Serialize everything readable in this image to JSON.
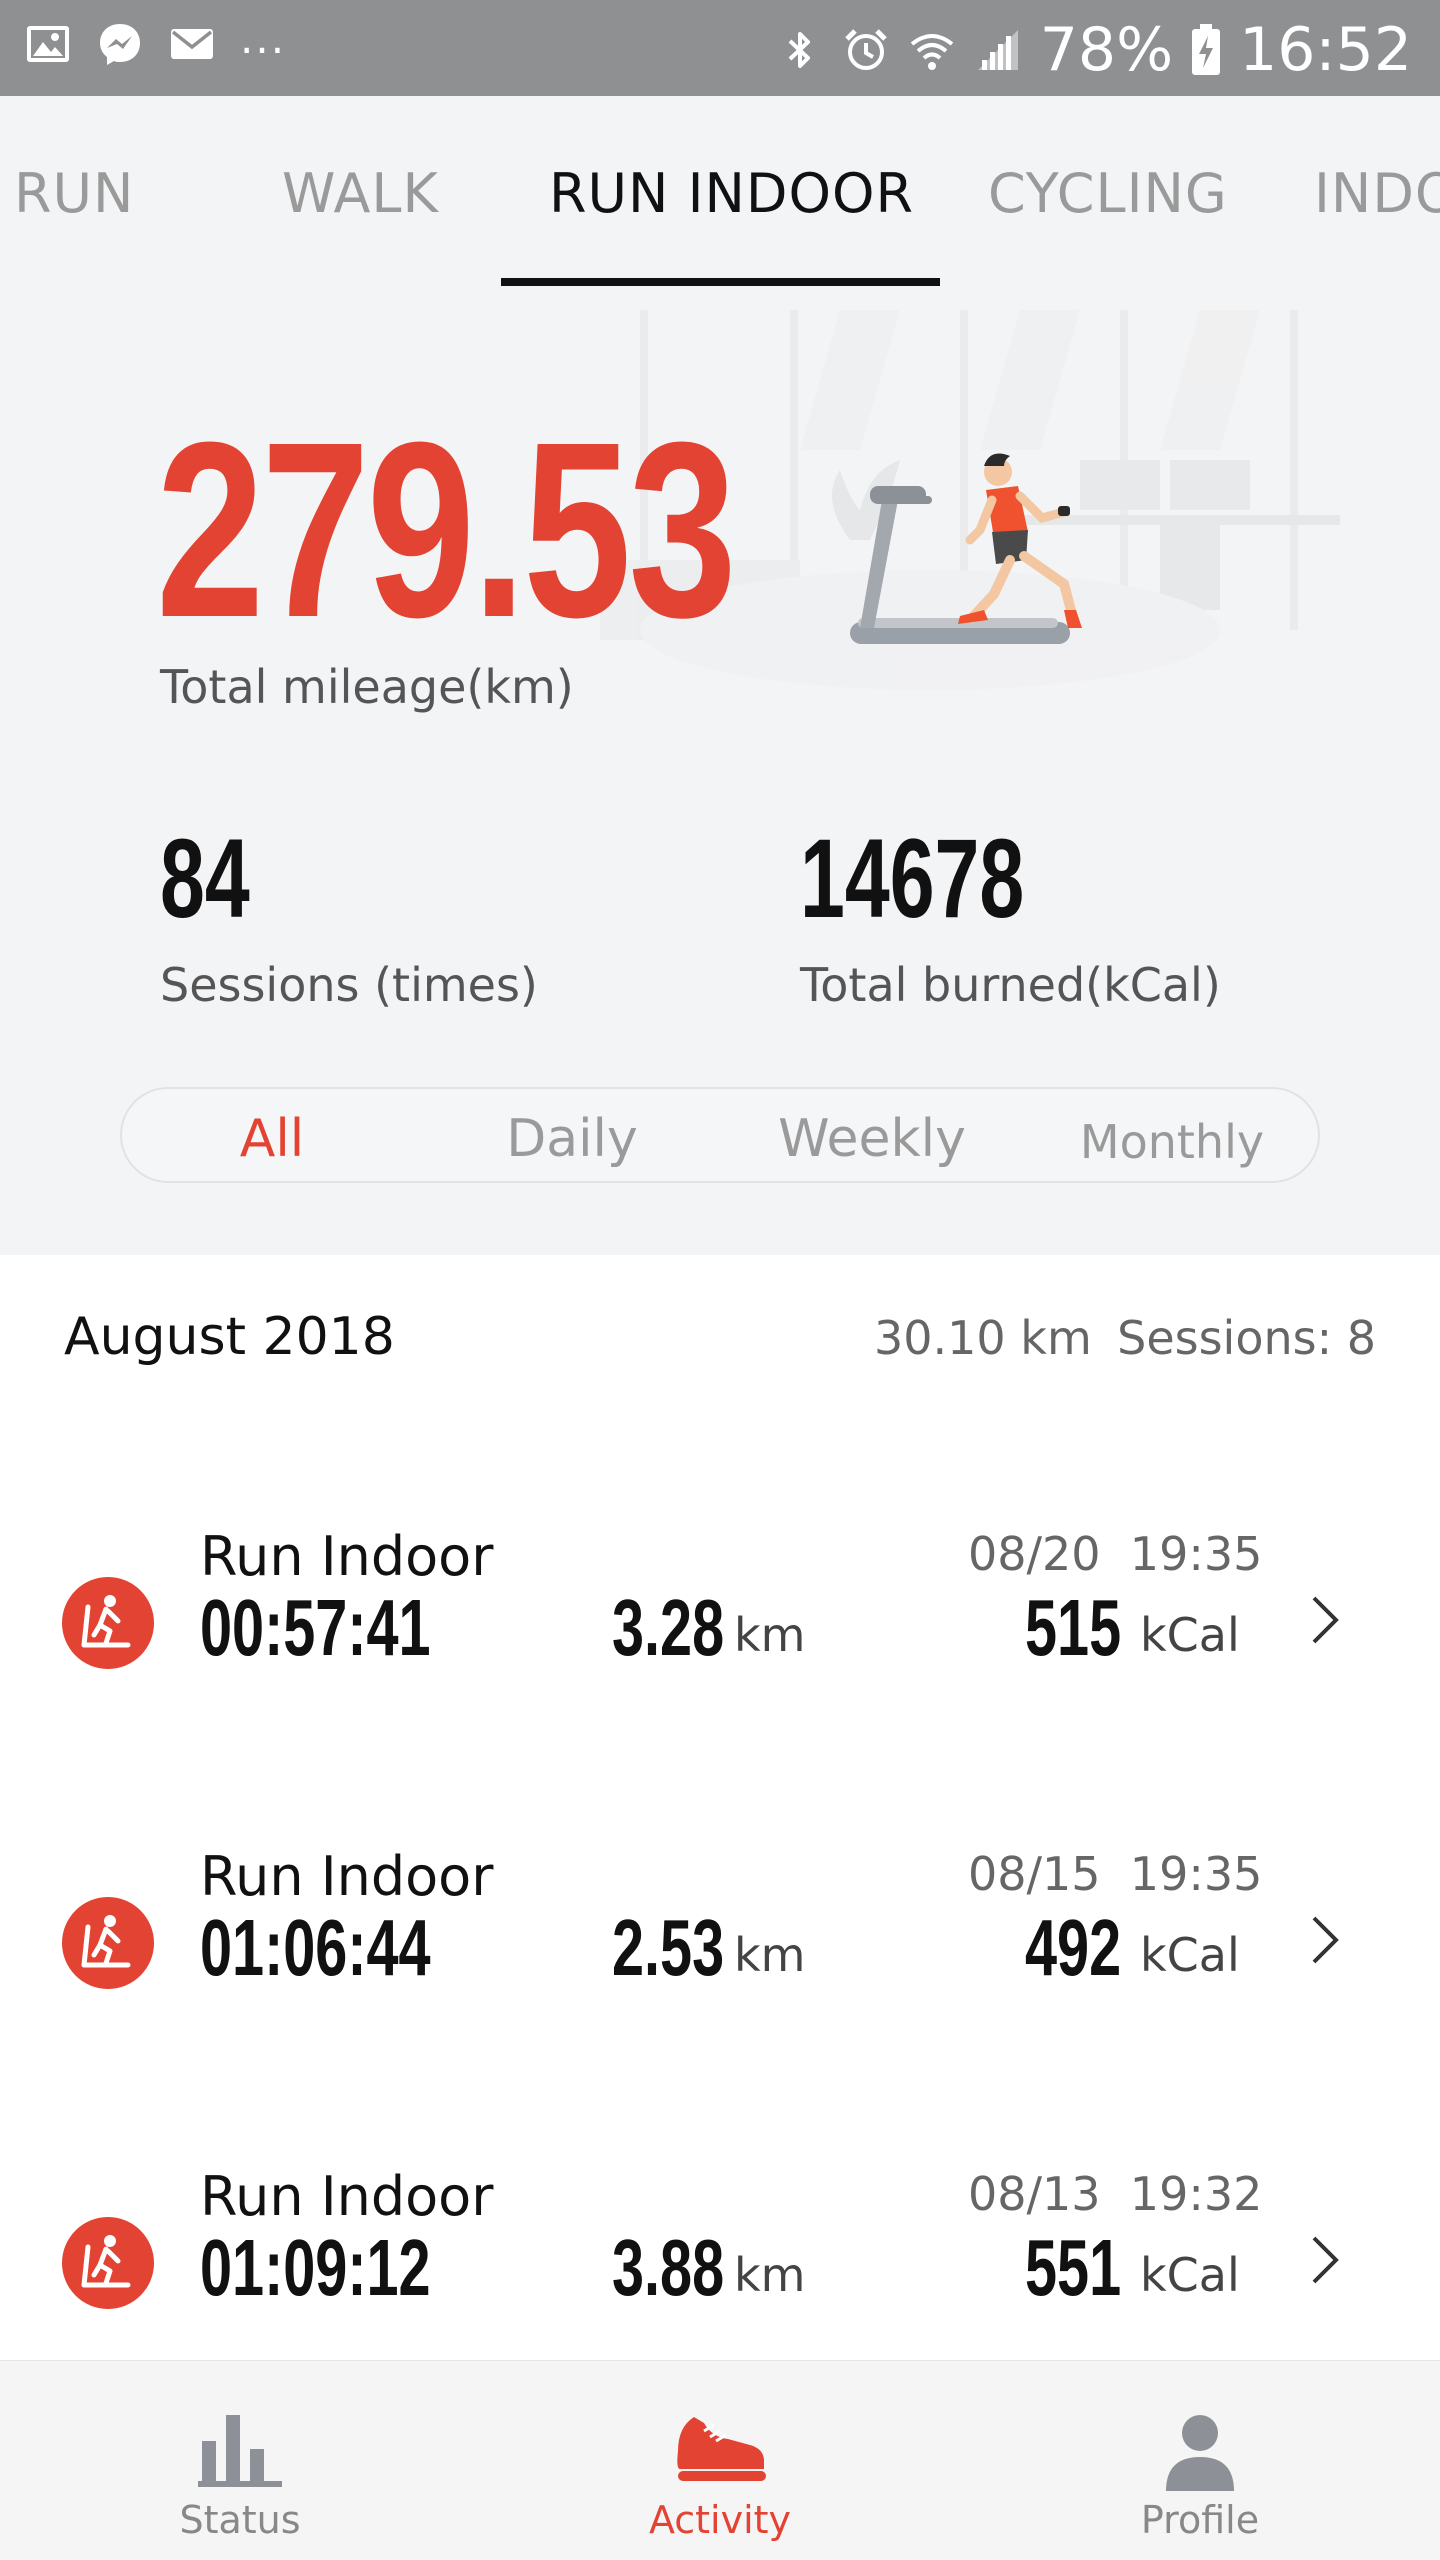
{
  "status_bar": {
    "left_icons": [
      "gallery-icon",
      "messenger-icon",
      "mail-icon"
    ],
    "more": "...",
    "right_icons": [
      "bluetooth-icon",
      "alarm-icon",
      "wifi-icon",
      "signal-icon"
    ],
    "battery_percent": "78%",
    "time": "16:52"
  },
  "tabs": [
    {
      "label": "RUN",
      "active": false
    },
    {
      "label": "WALK",
      "active": false
    },
    {
      "label": "RUN INDOOR",
      "active": true
    },
    {
      "label": "CYCLING",
      "active": false
    },
    {
      "label": "INDO",
      "active": false
    }
  ],
  "summary": {
    "total_mileage": "279.53",
    "total_mileage_label": "Total mileage(km)",
    "sessions": "84",
    "sessions_label": "Sessions (times)",
    "calories": "14678",
    "calories_label": "Total burned(kCal)"
  },
  "filter": {
    "options": [
      "All",
      "Daily",
      "Weekly",
      "Monthly"
    ],
    "selected": "All"
  },
  "month_group": {
    "title": "August 2018",
    "distance": "30.10 km",
    "sessions": "Sessions: 8"
  },
  "activities": [
    {
      "title": "Run Indoor",
      "date": "08/20  19:35",
      "duration": "00:57:41",
      "distance": "3.28",
      "distance_unit": "km",
      "calories": "515",
      "calories_unit": "kCal"
    },
    {
      "title": "Run Indoor",
      "date": "08/15  19:35",
      "duration": "01:06:44",
      "distance": "2.53",
      "distance_unit": "km",
      "calories": "492",
      "calories_unit": "kCal"
    },
    {
      "title": "Run Indoor",
      "date": "08/13  19:32",
      "duration": "01:09:12",
      "distance": "3.88",
      "distance_unit": "km",
      "calories": "551",
      "calories_unit": "kCal"
    }
  ],
  "bottom_nav": [
    {
      "label": "Status",
      "icon": "bar-chart-icon",
      "active": false
    },
    {
      "label": "Activity",
      "icon": "shoe-icon",
      "active": true
    },
    {
      "label": "Profile",
      "icon": "person-icon",
      "active": false
    }
  ],
  "colors": {
    "accent": "#e34332",
    "status_bar": "#8f9092",
    "background": "#f3f4f6"
  }
}
